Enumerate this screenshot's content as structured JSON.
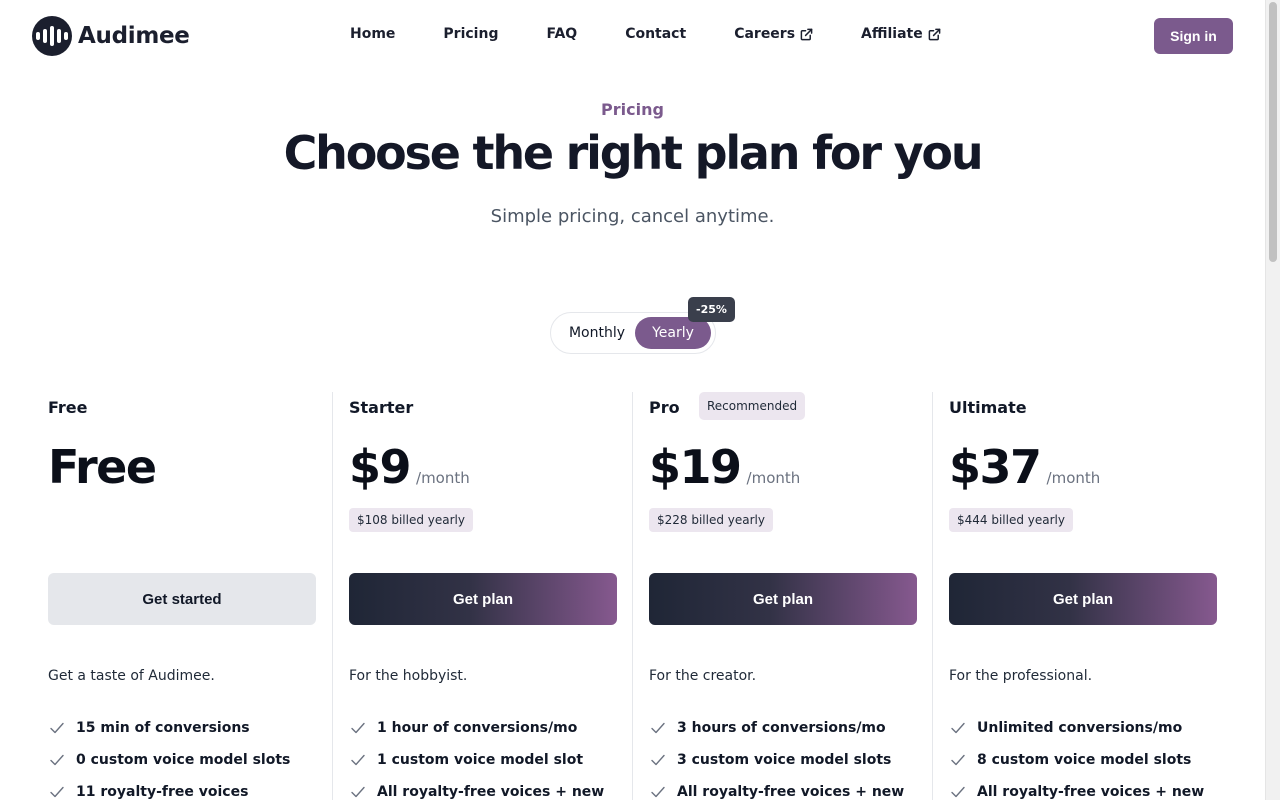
{
  "brand": {
    "name": "Audimee"
  },
  "nav": {
    "items": [
      {
        "label": "Home",
        "external": false
      },
      {
        "label": "Pricing",
        "external": false
      },
      {
        "label": "FAQ",
        "external": false
      },
      {
        "label": "Contact",
        "external": false
      },
      {
        "label": "Careers",
        "external": true
      },
      {
        "label": "Affiliate",
        "external": true
      }
    ],
    "signin_label": "Sign in"
  },
  "hero": {
    "eyebrow": "Pricing",
    "title": "Choose the right plan for you",
    "subtitle": "Simple pricing, cancel anytime."
  },
  "billing_toggle": {
    "monthly_label": "Monthly",
    "yearly_label": "Yearly",
    "selected": "Yearly",
    "discount_badge": "-25%"
  },
  "plans": [
    {
      "name": "Free",
      "badge": "",
      "price": "Free",
      "period": "",
      "billed": "",
      "button_label": "Get started",
      "description": "Get a taste of Audimee.",
      "features": [
        "15 min of conversions",
        "0 custom voice model slots",
        "11 royalty-free voices"
      ]
    },
    {
      "name": "Starter",
      "badge": "",
      "price": "$9",
      "period": "/month",
      "billed": "$108 billed yearly",
      "button_label": "Get plan",
      "description": "For the hobbyist.",
      "features": [
        "1 hour of conversions/mo",
        "1 custom voice model slot",
        "All royalty-free voices + new"
      ]
    },
    {
      "name": "Pro",
      "badge": "Recommended",
      "price": "$19",
      "period": "/month",
      "billed": "$228 billed yearly",
      "button_label": "Get plan",
      "description": "For the creator.",
      "features": [
        "3 hours of conversions/mo",
        "3 custom voice model slots",
        "All royalty-free voices + new"
      ]
    },
    {
      "name": "Ultimate",
      "badge": "",
      "price": "$37",
      "period": "/month",
      "billed": "$444 billed yearly",
      "button_label": "Get plan",
      "description": "For the professional.",
      "features": [
        "Unlimited conversions/mo",
        "8 custom voice model slots",
        "All royalty-free voices + new"
      ]
    }
  ],
  "colors": {
    "accent": "#7b5a8d",
    "dark": "#1b1f2e",
    "badge_bg": "#ece6ef"
  },
  "icons": [
    "waveform-logo-icon",
    "external-link-icon",
    "check-icon"
  ]
}
